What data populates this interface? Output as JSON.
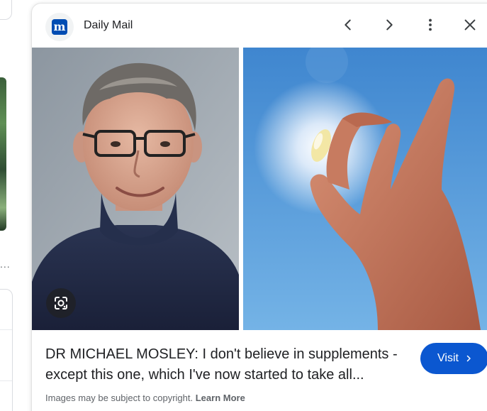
{
  "panel": {
    "source_name": "Daily Mail",
    "favicon_letter": "m",
    "favicon_color": "#004db3",
    "title": "DR MICHAEL MOSLEY: I don't believe in supplements - except this one, which I've now started to take all...",
    "visit_label": "Visit",
    "copyright_text": "Images may be subject to copyright.",
    "learn_more_label": "Learn More",
    "accent_color": "#0b57d0"
  },
  "icons": {
    "prev": "chevron-left-icon",
    "next": "chevron-right-icon",
    "more": "more-vert-icon",
    "close": "close-icon",
    "lens": "google-lens-icon"
  },
  "background": {
    "dots": "..."
  }
}
